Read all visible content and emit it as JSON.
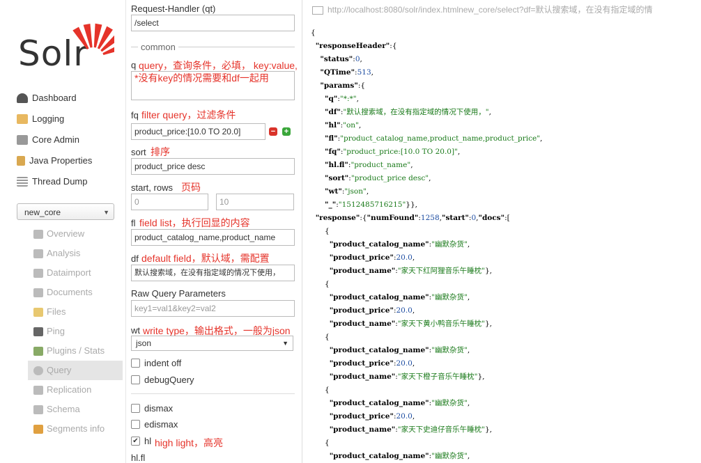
{
  "sidebar": {
    "logo_text": "Solr",
    "nav": [
      {
        "label": "Dashboard",
        "icon": "dashboard-icon",
        "color": "#555"
      },
      {
        "label": "Logging",
        "icon": "logging-icon",
        "color": "#e0a040"
      },
      {
        "label": "Core Admin",
        "icon": "core-admin-icon",
        "color": "#888"
      },
      {
        "label": "Java Properties",
        "icon": "java-properties-icon",
        "color": "#d09a40"
      },
      {
        "label": "Thread Dump",
        "icon": "thread-dump-icon",
        "color": "#999"
      }
    ],
    "core_selector": "new_core",
    "core_menu": [
      {
        "label": "Overview",
        "icon": "overview-icon"
      },
      {
        "label": "Analysis",
        "icon": "analysis-icon"
      },
      {
        "label": "Dataimport",
        "icon": "dataimport-icon"
      },
      {
        "label": "Documents",
        "icon": "documents-icon"
      },
      {
        "label": "Files",
        "icon": "files-icon"
      },
      {
        "label": "Ping",
        "icon": "ping-icon"
      },
      {
        "label": "Plugins / Stats",
        "icon": "plugins-icon"
      },
      {
        "label": "Query",
        "icon": "query-icon",
        "active": true
      },
      {
        "label": "Replication",
        "icon": "replication-icon"
      },
      {
        "label": "Schema",
        "icon": "schema-icon"
      },
      {
        "label": "Segments info",
        "icon": "segments-icon"
      }
    ]
  },
  "form": {
    "request_handler_label": "Request-Handler (qt)",
    "request_handler_value": "/select",
    "common_label": "common",
    "q_label": "q",
    "q_note": "query，查询条件，必填， key:value,",
    "q_value": "*没有key的情况需要和df一起用",
    "fq_label": "fq",
    "fq_note": "filter query，过滤条件",
    "fq_value": "product_price:[10.0 TO 20.0]",
    "sort_label": "sort",
    "sort_note": "排序",
    "sort_value": "product_price desc",
    "start_rows_label": "start, rows",
    "start_rows_note": "页码",
    "start_value": "0",
    "rows_value": "10",
    "fl_label": "fl",
    "fl_note": "field list，执行回显的内容",
    "fl_value": "product_catalog_name,product_name",
    "df_label": "df",
    "df_note": "default field，默认域，需配置",
    "df_value": "默认搜索域，在没有指定域的情况下使用，",
    "raw_label": "Raw Query Parameters",
    "raw_placeholder": "key1=val1&key2=val2",
    "wt_label": "wt",
    "wt_note": "write type，输出格式，一般为json",
    "wt_value": "json",
    "indent_label": "indent off",
    "debug_label": "debugQuery",
    "dismax_label": "dismax",
    "edismax_label": "edismax",
    "hl_label": "hl",
    "hl_note": "high light，高亮",
    "hlfl_label": "hl.fl"
  },
  "response": {
    "url": "http://localhost:8080/solr/index.htmlnew_core/select?df=默认搜索域，在没有指定域的情",
    "json_lines": [
      "{",
      "  \"responseHeader\":{",
      "    \"status\":0,",
      "    \"QTime\":513,",
      "    \"params\":{",
      "      \"q\":\"*:*\",",
      "      \"df\":\"默认搜索域，在没有指定域的情况下使用，\",",
      "      \"hl\":\"on\",",
      "      \"fl\":\"product_catalog_name,product_name,product_price\",",
      "      \"fq\":\"product_price:[10.0 TO 20.0]\",",
      "      \"hl.fl\":\"product_name\",",
      "      \"sort\":\"product_price desc\",",
      "      \"wt\":\"json\",",
      "      \"_\":\"1512485716215\"}},",
      "  \"response\":{\"numFound\":1258,\"start\":0,\"docs\":[",
      "      {",
      "        \"product_catalog_name\":\"幽默杂货\",",
      "        \"product_price\":20.0,",
      "        \"product_name\":\"家天下红阿狸音乐午睡枕\"},",
      "      {",
      "        \"product_catalog_name\":\"幽默杂货\",",
      "        \"product_price\":20.0,",
      "        \"product_name\":\"家天下黄小鸭音乐午睡枕\"},",
      "      {",
      "        \"product_catalog_name\":\"幽默杂货\",",
      "        \"product_price\":20.0,",
      "        \"product_name\":\"家天下橙子音乐午睡枕\"},",
      "      {",
      "        \"product_catalog_name\":\"幽默杂货\",",
      "        \"product_price\":20.0,",
      "        \"product_name\":\"家天下史迪仔音乐午睡枕\"},",
      "      {",
      "        \"product_catalog_name\":\"幽默杂货\","
    ]
  }
}
